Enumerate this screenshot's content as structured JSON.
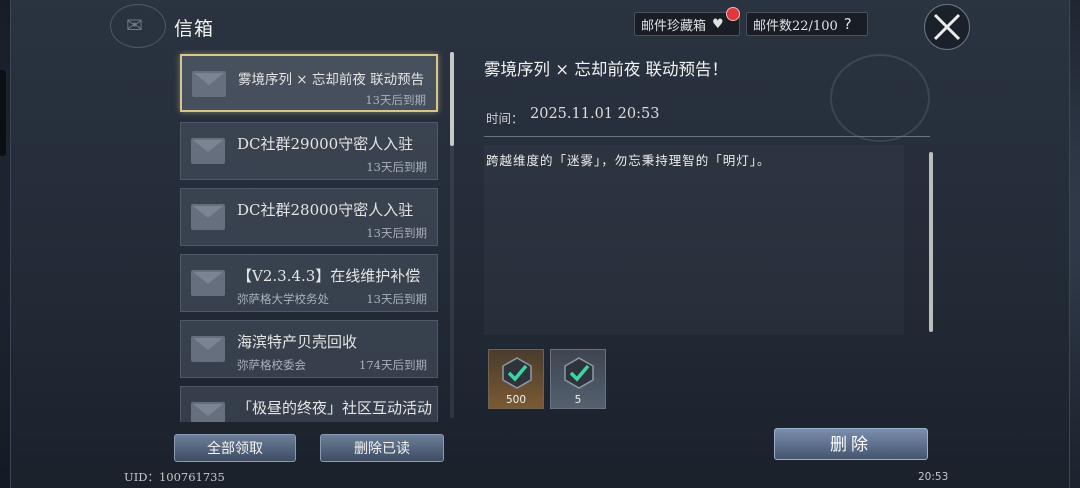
{
  "header": {
    "title": "信箱",
    "fav_label": "邮件珍藏箱",
    "count_label": "邮件数22/100",
    "help_glyph": "?"
  },
  "mails": [
    {
      "subject": "雾境序列 × 忘却前夜 联动预告",
      "sender": "",
      "expiry": "13天后到期",
      "active": true
    },
    {
      "subject": "DC社群29000守密人入驻",
      "sender": "",
      "expiry": "13天后到期",
      "active": false
    },
    {
      "subject": "DC社群28000守密人入驻",
      "sender": "",
      "expiry": "13天后到期",
      "active": false
    },
    {
      "subject": "【V2.3.4.3】在线维护补偿",
      "sender": "弥萨格大学校务处",
      "expiry": "13天后到期",
      "active": false
    },
    {
      "subject": "海滨特产贝壳回收",
      "sender": "弥萨格校委会",
      "expiry": "174天后到期",
      "active": false
    },
    {
      "subject": "「极昼的终夜」社区互动活动",
      "sender": "",
      "expiry": "",
      "active": false
    }
  ],
  "buttons": {
    "claim_all": "全部领取",
    "delete_read": "删除已读",
    "delete": "删除"
  },
  "detail": {
    "title": "雾境序列 × 忘却前夜 联动预告！",
    "time_label": "时间：",
    "time": "2025.11.01 20:53",
    "body": "跨越维度的「迷雾」，勿忘秉持理智的「明灯」。"
  },
  "rewards": [
    {
      "icon": "check-badge-icon",
      "qty": "500",
      "color": "orange"
    },
    {
      "icon": "check-badge-icon",
      "qty": "5",
      "color": "gray"
    }
  ],
  "footer": {
    "uid": "UID：100761735",
    "clock": "20:53"
  },
  "colors": {
    "active_border": "#d8c78a",
    "notify_dot": "#e0363d"
  }
}
